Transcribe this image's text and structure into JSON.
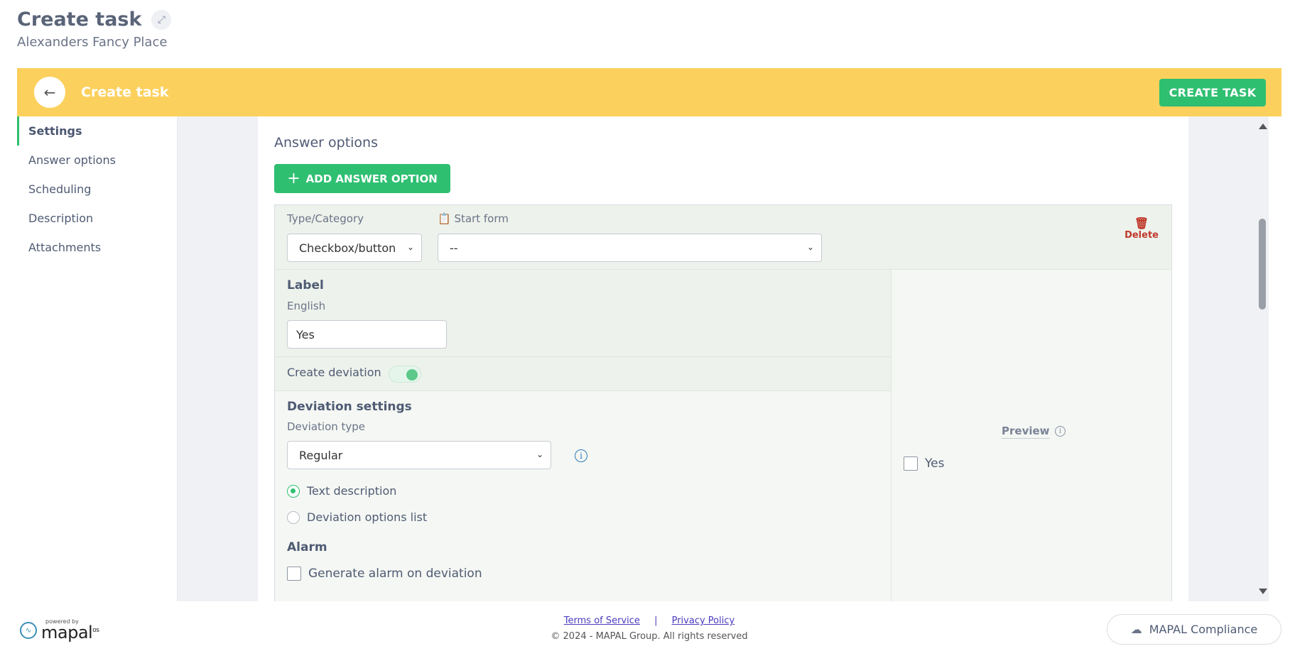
{
  "header": {
    "title": "Create task",
    "subtitle": "Alexanders Fancy Place",
    "expand_icon": "expand-icon"
  },
  "topbar": {
    "title": "Create task",
    "create_button": "CREATE TASK",
    "bg_color": "#fcd05c",
    "accent_color": "#2fbf71"
  },
  "sidebar": {
    "items": [
      {
        "label": "Settings",
        "active": true
      },
      {
        "label": "Answer options"
      },
      {
        "label": "Scheduling"
      },
      {
        "label": "Description"
      },
      {
        "label": "Attachments"
      }
    ]
  },
  "answer_options": {
    "section_title": "Answer options",
    "add_button": "ADD ANSWER OPTION",
    "type_label": "Type/Category",
    "type_value": "Checkbox/button",
    "start_form_label": "Start form",
    "start_form_value": "--",
    "delete_label": "Delete",
    "label_heading": "Label",
    "language_label": "English",
    "label_value": "Yes",
    "create_deviation_label": "Create deviation",
    "create_deviation_on": true,
    "deviation_settings_heading": "Deviation settings",
    "deviation_type_label": "Deviation type",
    "deviation_type_value": "Regular",
    "radio_text_description": "Text description",
    "radio_options_list": "Deviation options list",
    "alarm_heading": "Alarm",
    "alarm_checkbox_label": "Generate alarm on deviation",
    "preview_label": "Preview",
    "preview_option_label": "Yes"
  },
  "footer": {
    "powered_by": "powered by",
    "brand": "mapal",
    "brand_sup": "os",
    "terms": "Terms of Service",
    "separator": "|",
    "privacy": "Privacy Policy",
    "copyright": "© 2024 - MAPAL Group. All rights reserved",
    "mapal_button": "MAPAL Compliance"
  }
}
